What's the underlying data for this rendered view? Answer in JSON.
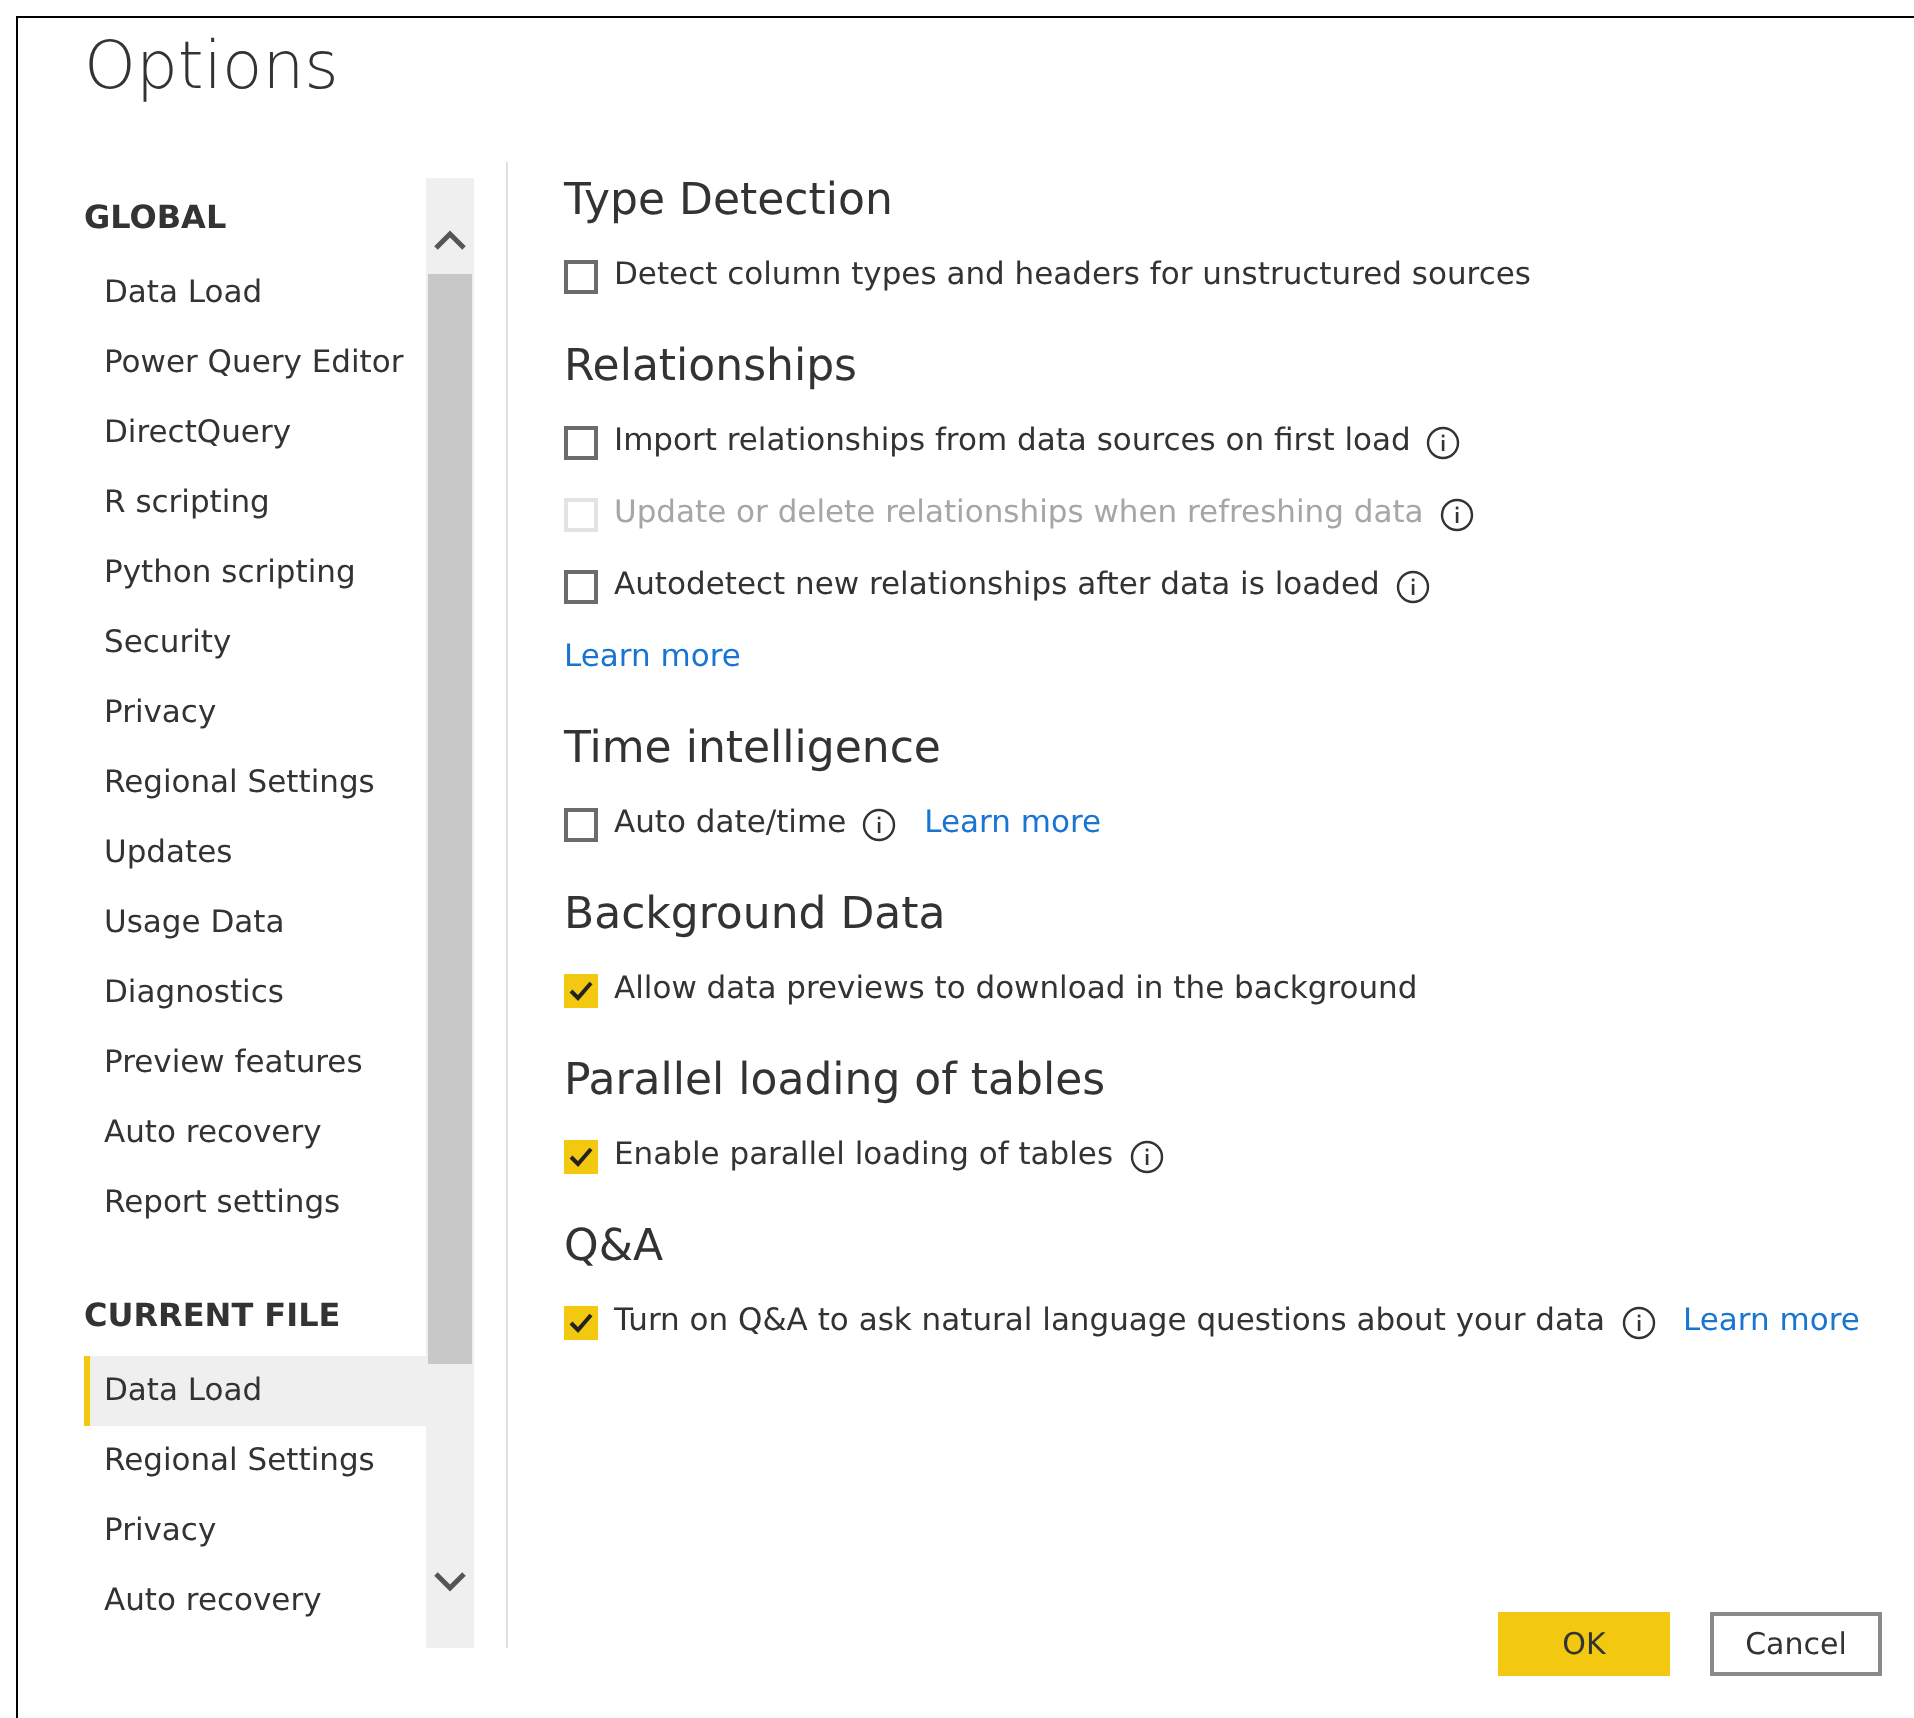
{
  "window": {
    "title": "Options"
  },
  "sidebar": {
    "groups": [
      {
        "heading": "GLOBAL",
        "items": [
          {
            "label": "Data Load",
            "selected": false
          },
          {
            "label": "Power Query Editor",
            "selected": false
          },
          {
            "label": "DirectQuery",
            "selected": false
          },
          {
            "label": "R scripting",
            "selected": false
          },
          {
            "label": "Python scripting",
            "selected": false
          },
          {
            "label": "Security",
            "selected": false
          },
          {
            "label": "Privacy",
            "selected": false
          },
          {
            "label": "Regional Settings",
            "selected": false
          },
          {
            "label": "Updates",
            "selected": false
          },
          {
            "label": "Usage Data",
            "selected": false
          },
          {
            "label": "Diagnostics",
            "selected": false
          },
          {
            "label": "Preview features",
            "selected": false
          },
          {
            "label": "Auto recovery",
            "selected": false
          },
          {
            "label": "Report settings",
            "selected": false
          }
        ]
      },
      {
        "heading": "CURRENT FILE",
        "items": [
          {
            "label": "Data Load",
            "selected": true
          },
          {
            "label": "Regional Settings",
            "selected": false
          },
          {
            "label": "Privacy",
            "selected": false
          },
          {
            "label": "Auto recovery",
            "selected": false
          }
        ]
      }
    ]
  },
  "sections": [
    {
      "title": "Type Detection",
      "options": [
        {
          "label": "Detect column types and headers for unstructured sources",
          "checked": false,
          "disabled": false,
          "info": false
        }
      ]
    },
    {
      "title": "Relationships",
      "options": [
        {
          "label": "Import relationships from data sources on first load",
          "checked": false,
          "disabled": false,
          "info": true
        },
        {
          "label": "Update or delete relationships when refreshing data",
          "checked": false,
          "disabled": true,
          "info": true
        },
        {
          "label": "Autodetect new relationships after data is loaded",
          "checked": false,
          "disabled": false,
          "info": true
        }
      ],
      "link": "Learn more"
    },
    {
      "title": "Time intelligence",
      "options": [
        {
          "label": "Auto date/time",
          "checked": false,
          "disabled": false,
          "info": true,
          "link": "Learn more"
        }
      ]
    },
    {
      "title": "Background Data",
      "options": [
        {
          "label": "Allow data previews to download in the background",
          "checked": true,
          "disabled": false,
          "info": false
        }
      ]
    },
    {
      "title": "Parallel loading of tables",
      "options": [
        {
          "label": "Enable parallel loading of tables",
          "checked": true,
          "disabled": false,
          "info": true
        }
      ]
    },
    {
      "title": "Q&A",
      "options": [
        {
          "label": "Turn on Q&A to ask natural language questions about your data",
          "checked": true,
          "disabled": false,
          "info": true,
          "link": "Learn more"
        }
      ]
    }
  ],
  "buttons": [
    {
      "label": "OK",
      "kind": "primary"
    },
    {
      "label": "Cancel",
      "kind": "secondary"
    }
  ]
}
